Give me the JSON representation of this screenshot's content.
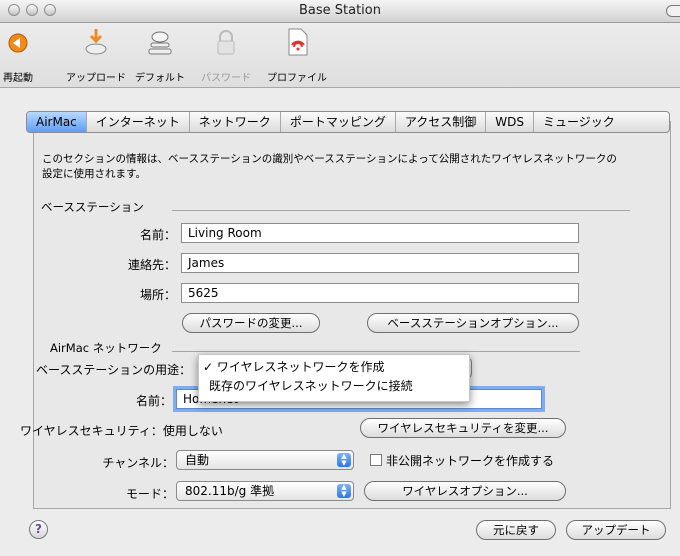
{
  "window": {
    "title": "Base Station"
  },
  "toolbar": {
    "restart": "再起動",
    "upload": "アップロード",
    "default": "デフォルト",
    "password": "パスワード",
    "profile": "プロファイル"
  },
  "tabs": [
    "AirMac",
    "インターネット",
    "ネットワーク",
    "ポートマッピング",
    "アクセス制御",
    "WDS",
    "ミュージック"
  ],
  "description": "このセクションの情報は、ベースステーションの識別やベースステーションによって公開されたワイヤレスネットワークの設定に使用されます。",
  "base_station": {
    "heading": "ベースステーション",
    "name_label": "名前：",
    "name_value": "Living Room",
    "contact_label": "連絡先：",
    "contact_value": "James",
    "location_label": "場所：",
    "location_value": "5625",
    "change_password_button": "パスワードの変更...",
    "options_button": "ベースステーションオプション..."
  },
  "airmac_network": {
    "heading": "AirMac ネットワーク",
    "usage_label": "ベースステーションの用途：",
    "menu_items": [
      "ワイヤレスネットワークを作成",
      "既存のワイヤレスネットワークに接続"
    ],
    "menu_checkmark": "✓",
    "name_label": "名前：",
    "name_value": "Homenet",
    "security_label": "ワイヤレスセキュリティ：使用しない",
    "security_button": "ワイヤレスセキュリティを変更...",
    "channel_label": "チャンネル：",
    "channel_value": "自動",
    "closed_network_label": "非公開ネットワークを作成する",
    "mode_label": "モード：",
    "mode_value": "802.11b/g 準拠",
    "wireless_options_button": "ワイヤレスオプション..."
  },
  "footer": {
    "help": "?",
    "revert_button": "元に戻す",
    "update_button": "アップデート"
  }
}
